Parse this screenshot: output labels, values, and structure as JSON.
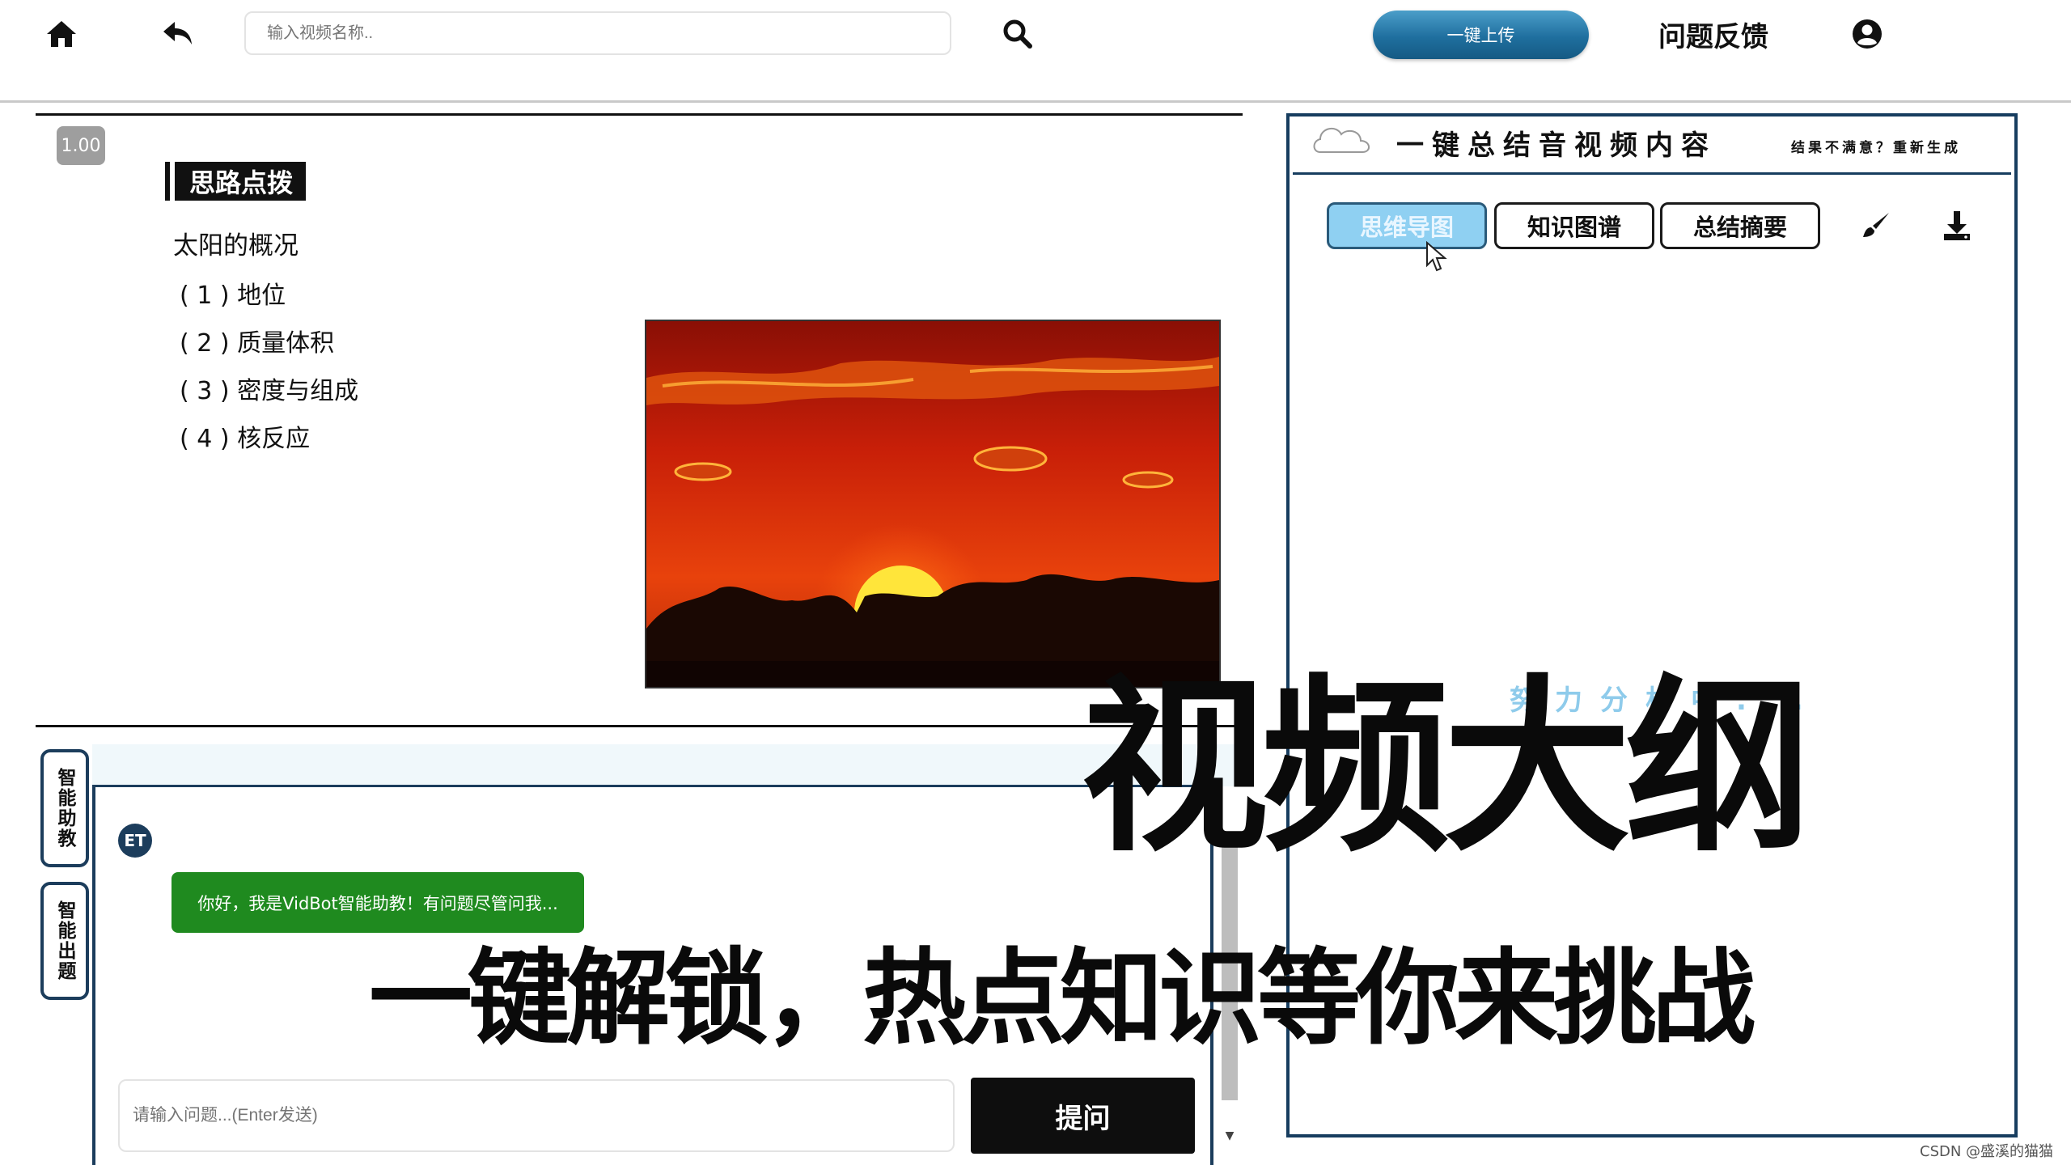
{
  "header": {
    "search_placeholder": "输入视频名称..",
    "upload_label": "一键上传",
    "feedback_label": "问题反馈"
  },
  "slide": {
    "speed": "1.00",
    "section_title": "思路点拨",
    "heading": "太阳的概况",
    "items": [
      "( 1 ) 地位",
      "( 2 ) 质量体积",
      "( 3 ) 密度与组成",
      "( 4 ) 核反应"
    ]
  },
  "summary_panel": {
    "title": "一键总结音视频内容",
    "regenerate": "结果不满意？重新生成",
    "tabs": [
      "思维导图",
      "知识图谱",
      "总结摘要"
    ],
    "active_tab": 0,
    "status": "努力分析中..."
  },
  "chat": {
    "side_tabs": [
      "智能助教",
      "智能出题"
    ],
    "avatar": "ET",
    "bot_message": "你好，我是VidBot智能助教！有问题尽管问我...",
    "input_placeholder": "请输入问题...(Enter发送)",
    "ask_label": "提问"
  },
  "overlay": {
    "title": "视频大纲",
    "subtitle": "一键解锁，热点知识等你来挑战"
  },
  "watermark": "CSDN @盛溪的猫猫",
  "colors": {
    "accent_blue": "#1f6f9f",
    "panel_border": "#173d5f",
    "bubble_green": "#1f8a1f",
    "active_tab": "#8fd0f2"
  }
}
